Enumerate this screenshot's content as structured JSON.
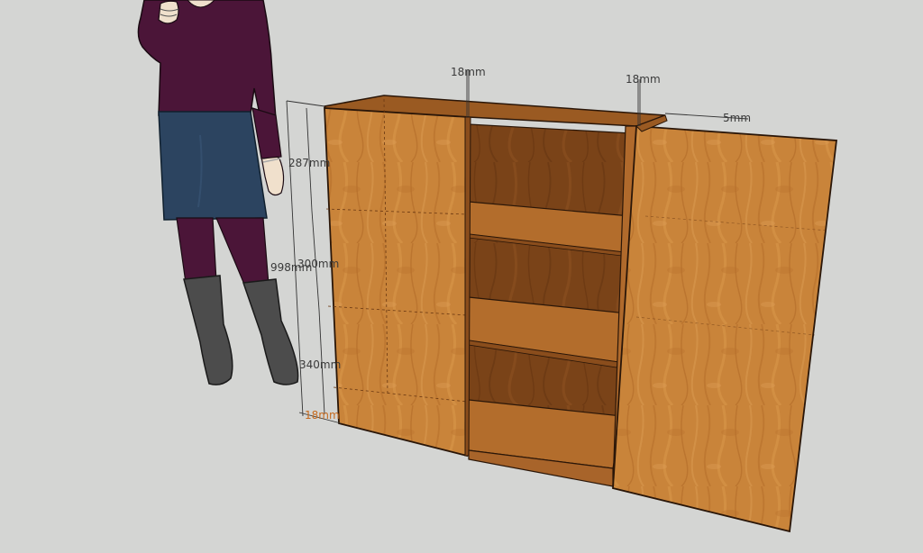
{
  "scene": {
    "background_color": "#d4d5d3",
    "wood_color": "#c9843a",
    "wood_dark_color": "#8a4d1c",
    "interior_color": "#6e3d18"
  },
  "dimensions": {
    "side_thickness_left": "18mm",
    "side_thickness_right": "18mm",
    "door_gap": "5mm",
    "top_section": "287mm",
    "total_height": "998mm",
    "middle_section": "300mm",
    "bottom_section": "340mm",
    "base_thickness": "18mm"
  }
}
